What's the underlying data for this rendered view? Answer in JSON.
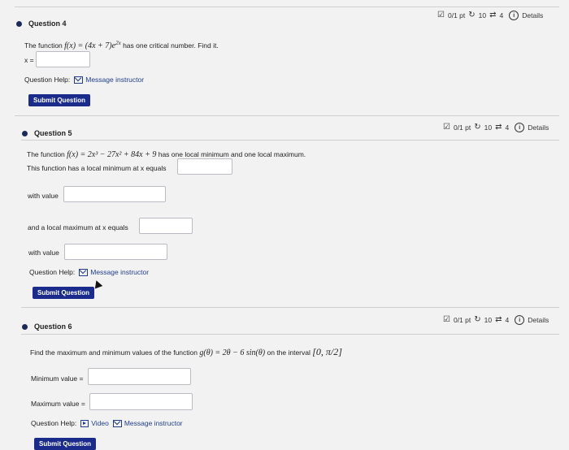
{
  "q4": {
    "title": "Question 4",
    "score": "0/1 pt",
    "tries": "10",
    "attempts": "4",
    "details": "Details",
    "prompt_prefix": "The function",
    "formula": "f(x) = (4x + 7)e",
    "exponent": "2x",
    "prompt_suffix": "has one critical number. Find it.",
    "answer_label": "x =",
    "help_label": "Question Help:",
    "help_link": "Message instructor",
    "submit": "Submit Question"
  },
  "q5": {
    "title": "Question 5",
    "score": "0/1 pt",
    "tries": "10",
    "attempts": "4",
    "details": "Details",
    "prompt_prefix": "The function",
    "formula": "f(x) = 2x³ − 27x² + 84x + 9",
    "prompt_suffix": "has one local minimum and one local maximum.",
    "line2": "This function has a local minimum at x equals",
    "with_value_1": "with value",
    "line3": "and a local maximum at x equals",
    "with_value_2": "with value",
    "help_label": "Question Help:",
    "help_link": "Message instructor",
    "submit": "Submit Question"
  },
  "q6": {
    "title": "Question 6",
    "score": "0/1 pt",
    "tries": "10",
    "attempts": "4",
    "details": "Details",
    "prompt_prefix": "Find the maximum and minimum values of the function",
    "formula": "g(θ) = 2θ − 6 sin(θ)",
    "prompt_mid": "on the interval",
    "interval": "[0, π/2]",
    "min_label": "Minimum value =",
    "max_label": "Maximum value =",
    "help_label": "Question Help:",
    "video_link": "Video",
    "help_link": "Message instructor",
    "submit": "Submit Question"
  }
}
